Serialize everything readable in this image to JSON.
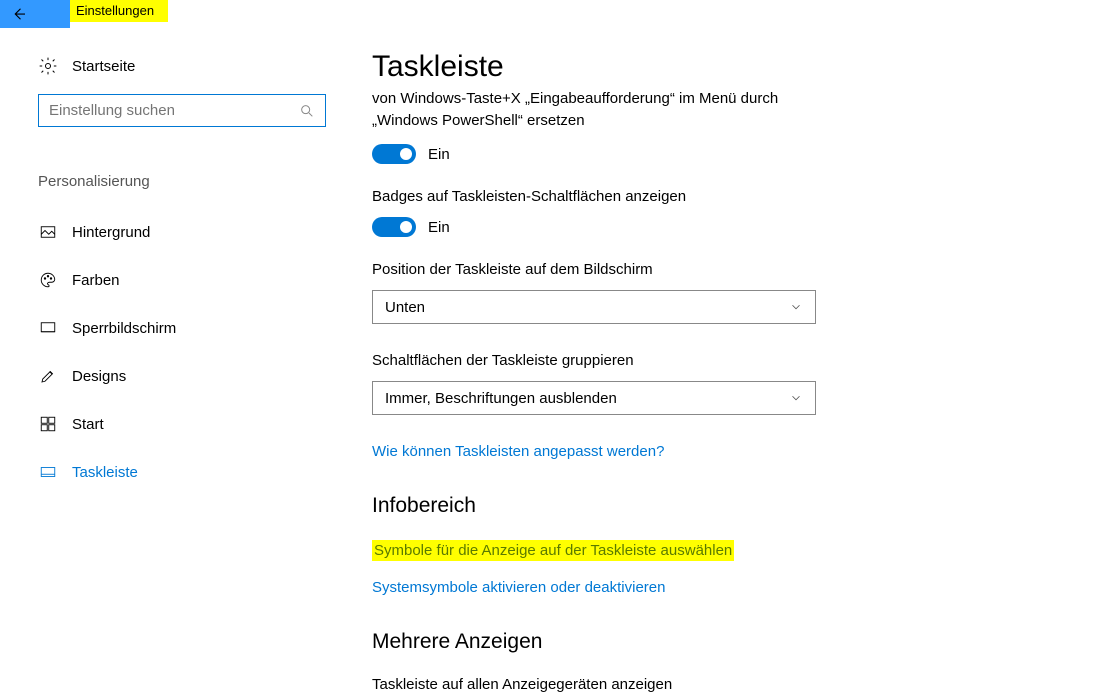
{
  "header": {
    "settings_label": "Einstellungen"
  },
  "sidebar": {
    "home_label": "Startseite",
    "search_placeholder": "Einstellung suchen",
    "category": "Personalisierung",
    "items": [
      {
        "label": "Hintergrund"
      },
      {
        "label": "Farben"
      },
      {
        "label": "Sperrbildschirm"
      },
      {
        "label": "Designs"
      },
      {
        "label": "Start"
      },
      {
        "label": "Taskleiste"
      }
    ]
  },
  "main": {
    "title": "Taskleiste",
    "clipped_line1": "von Windows-Taste+X „Eingabeaufforderung“ im Menü durch",
    "clipped_line2": "„Windows PowerShell“ ersetzen",
    "toggle1_state": "Ein",
    "badges_label": "Badges auf Taskleisten-Schaltflächen anzeigen",
    "toggle2_state": "Ein",
    "position_label": "Position der Taskleiste auf dem Bildschirm",
    "position_value": "Unten",
    "grouping_label": "Schaltflächen der Taskleiste gruppieren",
    "grouping_value": "Immer, Beschriftungen ausblenden",
    "customize_link": "Wie können Taskleisten angepasst werden?",
    "info_title": "Infobereich",
    "symbols_link": "Symbole für die Anzeige auf der Taskleiste auswählen",
    "syssymbols_link": "Systemsymbole aktivieren oder deaktivieren",
    "multi_title": "Mehrere Anzeigen",
    "multi_label": "Taskleiste auf allen Anzeigegeräten anzeigen"
  }
}
